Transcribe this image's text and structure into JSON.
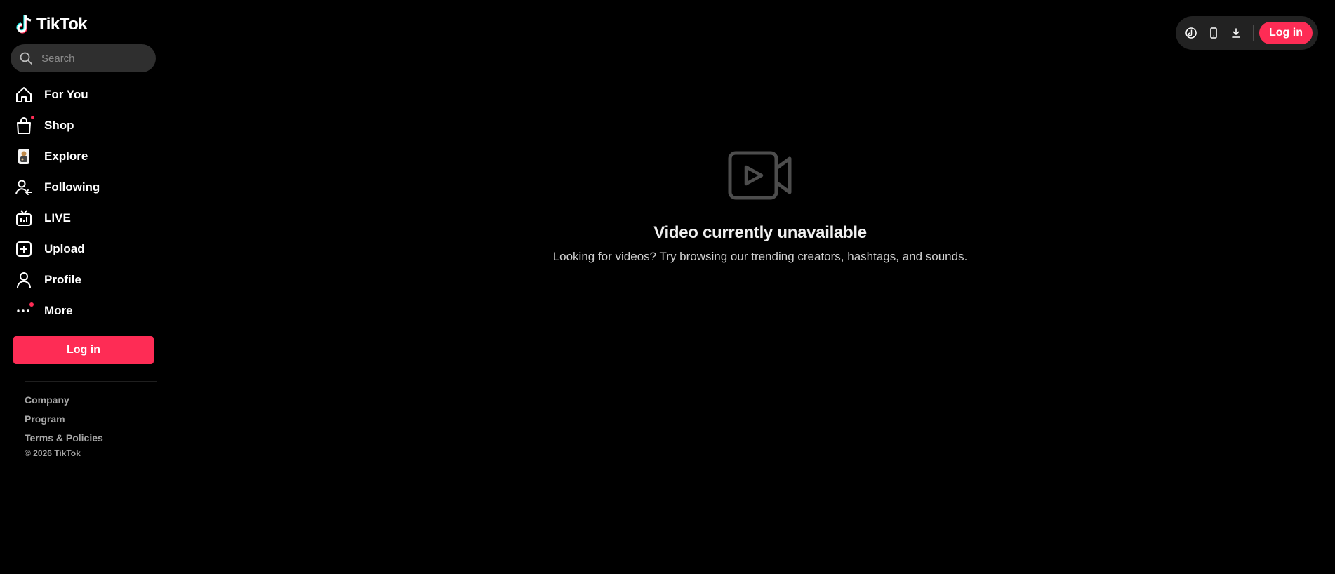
{
  "brand": {
    "name": "TikTok"
  },
  "search": {
    "placeholder": "Search"
  },
  "nav": {
    "items": [
      {
        "label": "For You",
        "icon": "home-icon"
      },
      {
        "label": "Shop",
        "icon": "shopping-bag-icon"
      },
      {
        "label": "Explore",
        "icon": "explore-icon"
      },
      {
        "label": "Following",
        "icon": "following-icon"
      },
      {
        "label": "LIVE",
        "icon": "live-tv-icon"
      },
      {
        "label": "Upload",
        "icon": "upload-plus-icon"
      },
      {
        "label": "Profile",
        "icon": "profile-icon"
      },
      {
        "label": "More",
        "icon": "more-dots-icon"
      }
    ]
  },
  "sidebar": {
    "login_label": "Log in"
  },
  "footer": {
    "links": [
      "Company",
      "Program",
      "Terms & Policies"
    ],
    "copyright": "© 2026 TikTok"
  },
  "header": {
    "login_label": "Log in",
    "icons": [
      "tiktok-coin-icon",
      "mobile-device-icon",
      "download-icon"
    ]
  },
  "main": {
    "title": "Video currently unavailable",
    "subtitle": "Looking for videos? Try browsing our trending creators, hashtags, and sounds."
  },
  "colors": {
    "accent": "#fe2c55",
    "background": "#000000",
    "pill": "#222222"
  }
}
